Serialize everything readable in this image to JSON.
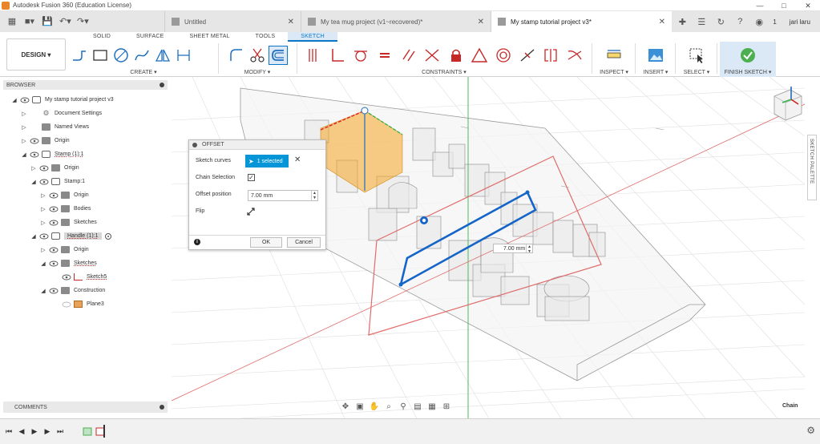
{
  "window": {
    "title": "Autodesk Fusion 360 (Education License)"
  },
  "tabs": [
    {
      "label": "Untitled",
      "active": false
    },
    {
      "label": "My tea mug project (v1~recovered)*",
      "active": false
    },
    {
      "label": "My stamp tutorial project v3*",
      "active": true
    }
  ],
  "header": {
    "notifications": "1",
    "user": "jari laru"
  },
  "ribbon": {
    "workspace": "DESIGN ▾",
    "tabs": [
      "SOLID",
      "SURFACE",
      "SHEET METAL",
      "TOOLS",
      "SKETCH"
    ],
    "active_tab": "SKETCH",
    "groups": {
      "create": "CREATE ▾",
      "modify": "MODIFY ▾",
      "constraints": "CONSTRAINTS ▾",
      "inspect": "INSPECT ▾",
      "insert": "INSERT ▾",
      "select": "SELECT ▾",
      "finish": "FINISH SKETCH ▾"
    }
  },
  "browser": {
    "title": "BROWSER",
    "items": [
      {
        "label": "My stamp tutorial project v3"
      },
      {
        "label": "Document Settings"
      },
      {
        "label": "Named Views"
      },
      {
        "label": "Origin"
      },
      {
        "label": "Stamp (1):1"
      },
      {
        "label": "Origin"
      },
      {
        "label": "Stamp:1"
      },
      {
        "label": "Origin"
      },
      {
        "label": "Bodies"
      },
      {
        "label": "Sketches"
      },
      {
        "label": "Handle (1):1"
      },
      {
        "label": "Origin"
      },
      {
        "label": "Sketches"
      },
      {
        "label": "Sketch5"
      },
      {
        "label": "Construction"
      },
      {
        "label": "Plane3"
      }
    ]
  },
  "comments": {
    "title": "COMMENTS"
  },
  "offset_dialog": {
    "title": "OFFSET",
    "sketch_curves_label": "Sketch curves",
    "selection": "1 selected",
    "chain_selection_label": "Chain Selection",
    "chain_selection_checked": true,
    "offset_position_label": "Offset position",
    "offset_value": "7.00 mm",
    "flip_label": "Flip",
    "ok": "OK",
    "cancel": "Cancel"
  },
  "canvas": {
    "measure_value": "7.00 mm",
    "sketch_palette": "SKETCH PALETTE",
    "status": "Chain"
  },
  "colors": {
    "accent": "#0696d7",
    "sketch_profile": "#1565c8",
    "plane": "#e06b6b",
    "axis_green": "#3ab54a",
    "face_highlight": "#f5a623"
  }
}
